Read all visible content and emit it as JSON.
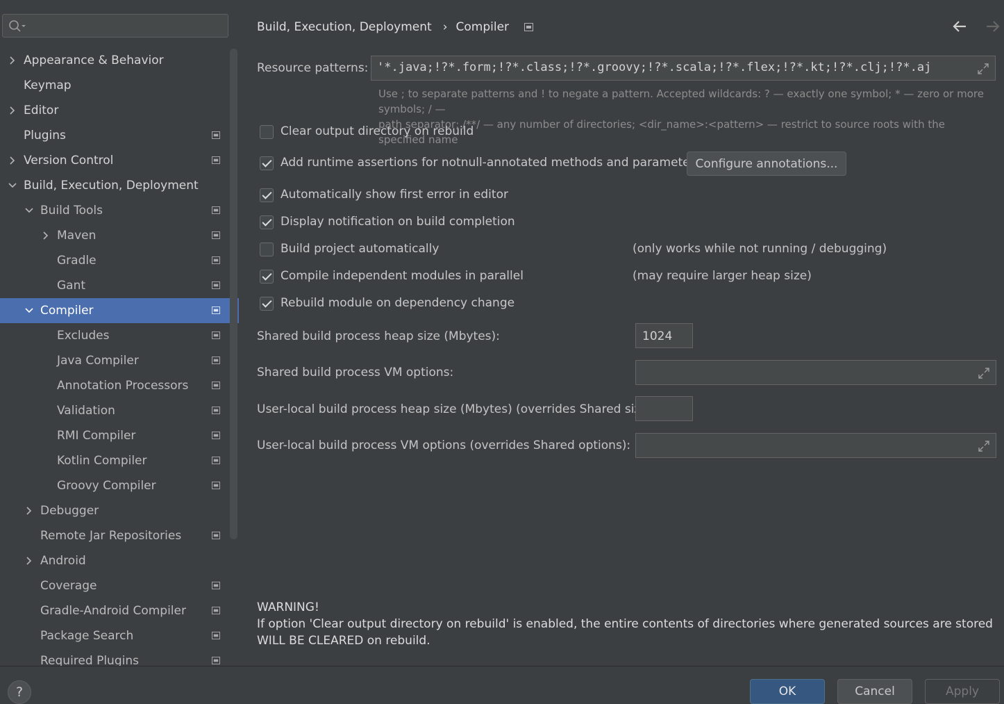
{
  "search": {
    "placeholder": ""
  },
  "sidebar": {
    "items": [
      {
        "label": "Appearance & Behavior",
        "level": 0,
        "arrow": "right"
      },
      {
        "label": "Keymap",
        "level": 0,
        "arrow": "none"
      },
      {
        "label": "Editor",
        "level": 0,
        "arrow": "right"
      },
      {
        "label": "Plugins",
        "level": 0,
        "arrow": "none",
        "project_icon": true
      },
      {
        "label": "Version Control",
        "level": 0,
        "arrow": "right",
        "project_icon": true
      },
      {
        "label": "Build, Execution, Deployment",
        "level": 0,
        "arrow": "down"
      },
      {
        "label": "Build Tools",
        "level": 1,
        "arrow": "down",
        "project_icon": true
      },
      {
        "label": "Maven",
        "level": 2,
        "arrow": "right",
        "project_icon": true
      },
      {
        "label": "Gradle",
        "level": 2,
        "arrow": "none",
        "project_icon": true
      },
      {
        "label": "Gant",
        "level": 2,
        "arrow": "none",
        "project_icon": true
      },
      {
        "label": "Compiler",
        "level": 1,
        "arrow": "down",
        "project_icon": true,
        "selected": true
      },
      {
        "label": "Excludes",
        "level": 2,
        "arrow": "none",
        "project_icon": true
      },
      {
        "label": "Java Compiler",
        "level": 2,
        "arrow": "none",
        "project_icon": true
      },
      {
        "label": "Annotation Processors",
        "level": 2,
        "arrow": "none",
        "project_icon": true
      },
      {
        "label": "Validation",
        "level": 2,
        "arrow": "none",
        "project_icon": true
      },
      {
        "label": "RMI Compiler",
        "level": 2,
        "arrow": "none",
        "project_icon": true
      },
      {
        "label": "Kotlin Compiler",
        "level": 2,
        "arrow": "none",
        "project_icon": true
      },
      {
        "label": "Groovy Compiler",
        "level": 2,
        "arrow": "none",
        "project_icon": true
      },
      {
        "label": "Debugger",
        "level": 1,
        "arrow": "right"
      },
      {
        "label": "Remote Jar Repositories",
        "level": 1,
        "arrow": "none",
        "project_icon": true
      },
      {
        "label": "Android",
        "level": 1,
        "arrow": "right"
      },
      {
        "label": "Coverage",
        "level": 1,
        "arrow": "none",
        "project_icon": true
      },
      {
        "label": "Gradle-Android Compiler",
        "level": 1,
        "arrow": "none",
        "project_icon": true
      },
      {
        "label": "Package Search",
        "level": 1,
        "arrow": "none",
        "project_icon": true
      },
      {
        "label": "Required Plugins",
        "level": 1,
        "arrow": "none",
        "project_icon": true
      }
    ]
  },
  "breadcrumb": {
    "parent": "Build, Execution, Deployment",
    "current": "Compiler"
  },
  "resource": {
    "label": "Resource patterns:",
    "value": "'*.java;!?*.form;!?*.class;!?*.groovy;!?*.scala;!?*.flex;!?*.kt;!?*.clj;!?*.aj",
    "hint_line1": "Use ; to separate patterns and ! to negate a pattern. Accepted wildcards: ? — exactly one symbol; * — zero or more symbols; / —",
    "hint_line2": "path separator; /**/ — any number of directories; <dir_name>:<pattern> — restrict to source roots with the specified name"
  },
  "options": {
    "clear_output": {
      "label": "Clear output directory on rebuild",
      "checked": false
    },
    "runtime_assertions": {
      "label": "Add runtime assertions for notnull-annotated methods and parameters",
      "checked": true,
      "button": "Configure annotations..."
    },
    "show_first_error": {
      "label": "Automatically show first error in editor",
      "checked": true
    },
    "notify_completion": {
      "label": "Display notification on build completion",
      "checked": true
    },
    "build_auto": {
      "label": "Build project automatically",
      "checked": false,
      "note": "(only works while not running / debugging)"
    },
    "parallel": {
      "label": "Compile independent modules in parallel",
      "checked": true,
      "note": "(may require larger heap size)"
    },
    "rebuild_dep": {
      "label": "Rebuild module on dependency change",
      "checked": true
    }
  },
  "heap": {
    "shared_label": "Shared build process heap size (Mbytes):",
    "shared_value": "1024",
    "shared_vm_label": "Shared build process VM options:",
    "shared_vm_value": "",
    "local_label": "User-local build process heap size (Mbytes) (overrides Shared size):",
    "local_value": "",
    "local_vm_label": "User-local build process VM options (overrides Shared options):",
    "local_vm_value": ""
  },
  "warning": {
    "title": "WARNING!",
    "line1": "If option 'Clear output directory on rebuild' is enabled, the entire contents of directories where generated sources are stored",
    "line2": "WILL BE CLEARED on rebuild."
  },
  "buttons": {
    "ok": "OK",
    "cancel": "Cancel",
    "apply": "Apply",
    "help": "?"
  },
  "colors": {
    "selection": "#4b6eaf",
    "background": "#3c3f41",
    "primary_button": "#365880"
  }
}
